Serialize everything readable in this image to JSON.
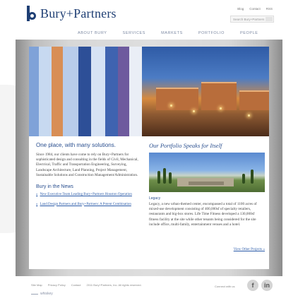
{
  "header": {
    "brand": "Bury+Partners",
    "utility_links": [
      "Blog",
      "Contact",
      "RSS"
    ],
    "search_placeholder": "Search Bury+Partners"
  },
  "nav": {
    "items": [
      "ABOUT BURY",
      "SERVICES",
      "MARKETS",
      "PORTFOLIO",
      "PEOPLE"
    ]
  },
  "intro": {
    "heading": "One place, with many solutions.",
    "body": "Since 1984, our clients have come to rely on Bury+Partners for sophisticated design and consulting in the fields of Civil, Mechanical, Electrical, Traffic and Transportation Engineering, Surveying, Landscape Architecture, Land Planning, Project Management, Sustainable Solutions and Construction Management/Administration."
  },
  "news": {
    "heading": "Bury in the News",
    "items": [
      "New Executive Team Leading Bury+Partners Houston Operation",
      "Land Design Partners and Bury+Partners: A Potent Combination"
    ]
  },
  "portfolio": {
    "heading": "Our Portfolio Speaks for Itself",
    "project_label": "Legacy",
    "body": "Legacy, a new urban-themed center, encompassed a total of 1100 acres of mixed-use development consisting of 400,000sf of specialty retailers, restaurants and big-box stores. Life Time Fitness developed a 130,000sf fitness facility at the site while other tenants being considered for the site include office, multi-family, entertainment venues and a hotel.",
    "view_link": "View Other Projects »"
  },
  "footer": {
    "links": [
      "Site Map",
      "Privacy Policy",
      "Contact",
      "2011 Bury+Partners, Inc. All rights reserved."
    ],
    "credit": "whiskey",
    "connect_label": "Connect with us",
    "social": {
      "facebook": "f",
      "linkedin": "in"
    }
  },
  "colors": {
    "brand": "#1f3f74",
    "heading": "#2a4f8f",
    "link": "#2a5aa8"
  }
}
